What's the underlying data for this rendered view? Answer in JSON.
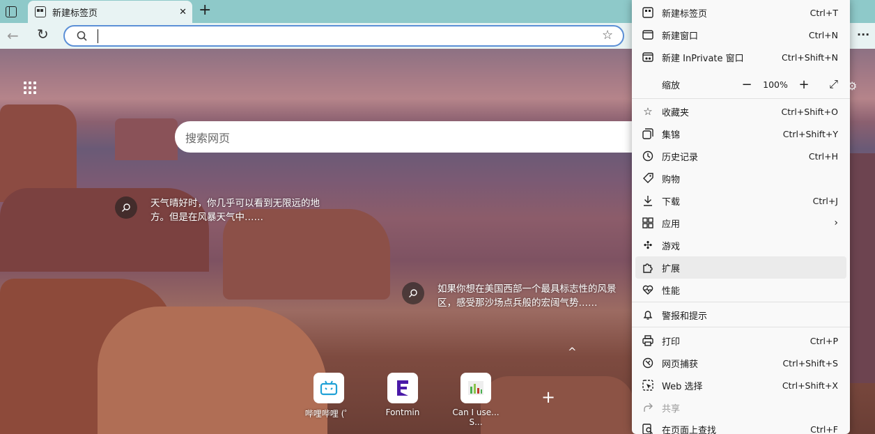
{
  "tab": {
    "title": "新建标签页",
    "close": "✕",
    "new_tab": "+"
  },
  "address": {
    "value": "",
    "placeholder": ""
  },
  "ntp": {
    "search_placeholder": "搜索网页",
    "info1": "天气晴好时，你几乎可以看到无限远的地方。但是在风暴天气中……",
    "info2": "如果你想在美国西部一个最具标志性的风景区，感受那沙场点兵般的宏阔气势……",
    "tiles": [
      {
        "label": "哔哩哔哩 (゜"
      },
      {
        "label": "Fontmin"
      },
      {
        "label": "Can I use... S..."
      }
    ],
    "add_tile": "+",
    "collapse": "^"
  },
  "menu": {
    "items": [
      {
        "label": "新建标签页",
        "shortcut": "Ctrl+T"
      },
      {
        "label": "新建窗口",
        "shortcut": "Ctrl+N"
      },
      {
        "label": "新建 InPrivate 窗口",
        "shortcut": "Ctrl+Shift+N"
      },
      {
        "label": "缩放",
        "zoom": "100%"
      },
      {
        "label": "收藏夹",
        "shortcut": "Ctrl+Shift+O"
      },
      {
        "label": "集锦",
        "shortcut": "Ctrl+Shift+Y"
      },
      {
        "label": "历史记录",
        "shortcut": "Ctrl+H"
      },
      {
        "label": "购物",
        "shortcut": ""
      },
      {
        "label": "下载",
        "shortcut": "Ctrl+J"
      },
      {
        "label": "应用",
        "shortcut": ""
      },
      {
        "label": "游戏",
        "shortcut": ""
      },
      {
        "label": "扩展",
        "shortcut": ""
      },
      {
        "label": "性能",
        "shortcut": ""
      },
      {
        "label": "警报和提示",
        "shortcut": ""
      },
      {
        "label": "打印",
        "shortcut": "Ctrl+P"
      },
      {
        "label": "网页捕获",
        "shortcut": "Ctrl+Shift+S"
      },
      {
        "label": "Web 选择",
        "shortcut": "Ctrl+Shift+X"
      },
      {
        "label": "共享",
        "shortcut": ""
      },
      {
        "label": "在页面上查找",
        "shortcut": "Ctrl+F"
      }
    ]
  },
  "more_button": "···",
  "colors": {
    "accent": "#5b8fd6",
    "titlebar": "#8ec9c9",
    "toolbar": "#e8f3f3"
  }
}
